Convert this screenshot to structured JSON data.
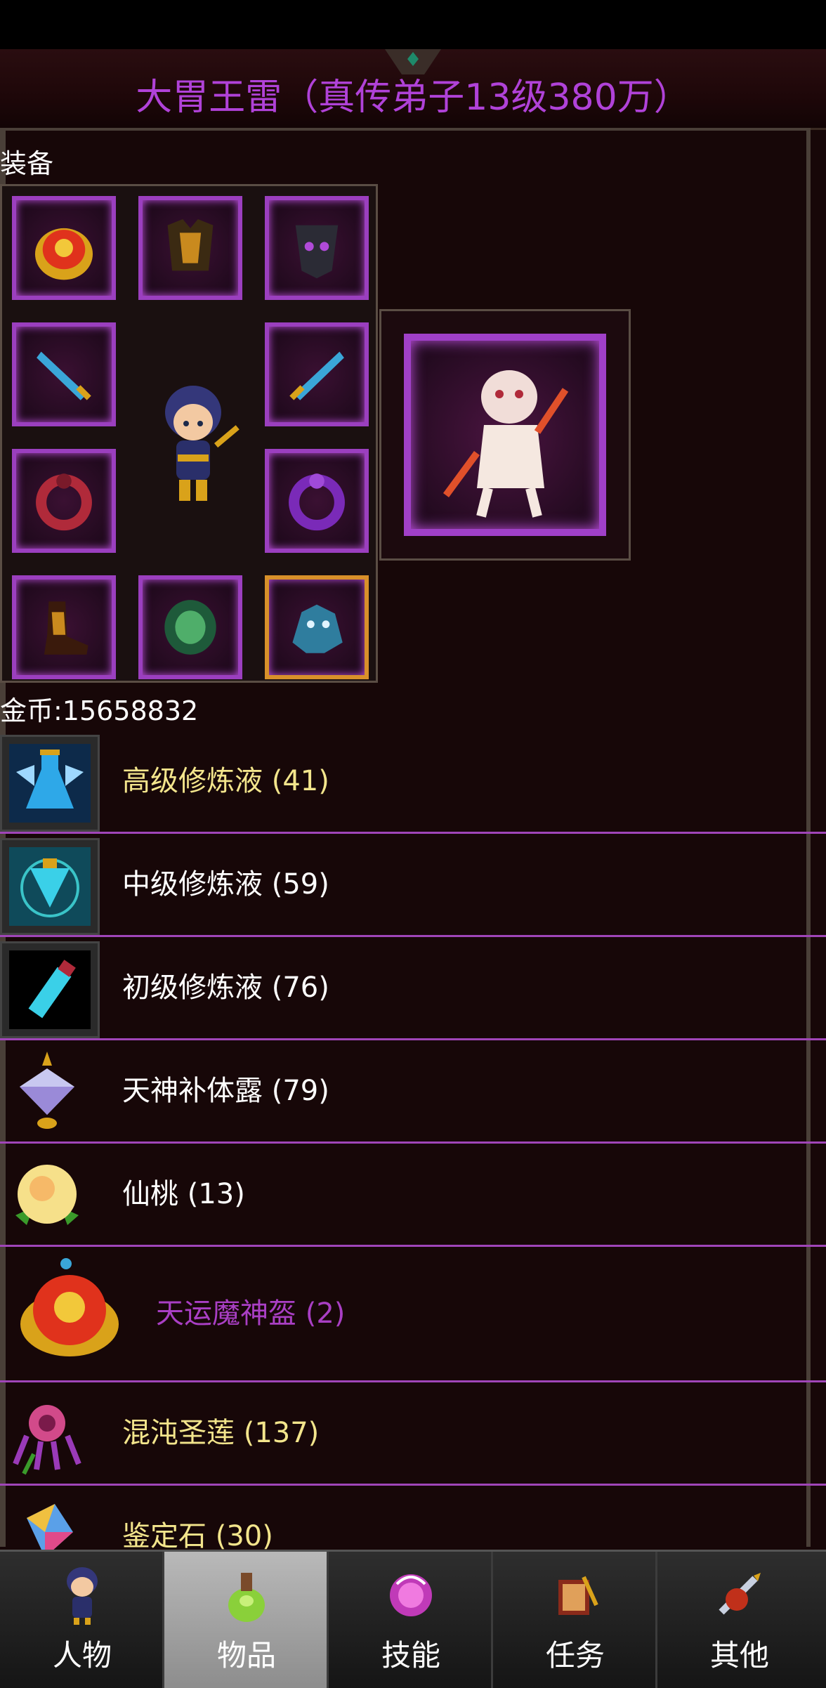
{
  "header": {
    "title": "大胃王雷（真传弟子13级380万）"
  },
  "equipment": {
    "label": "装备",
    "slots": [
      {
        "icon": "helmet-icon"
      },
      {
        "icon": "armor-icon"
      },
      {
        "icon": "mask-icon"
      },
      {
        "icon": "sword-icon"
      },
      {
        "icon": "sword-icon"
      },
      {
        "icon": "ring-icon"
      },
      {
        "icon": "ring-icon"
      },
      {
        "icon": "boots-icon"
      },
      {
        "icon": "belt-icon"
      },
      {
        "icon": "mount-icon"
      }
    ],
    "pet_icon": "monkey-pet-icon"
  },
  "gold": "金币:15658832",
  "items": [
    {
      "name": "高级修炼液 (41)",
      "color": "#f3e58c",
      "icon": "potion-flask-icon"
    },
    {
      "name": "中级修炼液 (59)",
      "color": "#ffffff",
      "icon": "potion-bottle-icon"
    },
    {
      "name": "初级修炼液 (76)",
      "color": "#ffffff",
      "icon": "vial-icon"
    },
    {
      "name": "天神补体露 (79)",
      "color": "#ffffff",
      "icon": "crystal-icon"
    },
    {
      "name": "仙桃 (13)",
      "color": "#ffffff",
      "icon": "peach-icon"
    },
    {
      "name": "天运魔神盔 (2)",
      "color": "#a93fc4",
      "icon": "helmet-icon"
    },
    {
      "name": "混沌圣莲 (137)",
      "color": "#f3e58c",
      "icon": "lotus-icon"
    },
    {
      "name": "鉴定石 (30)",
      "color": "#f3e58c",
      "icon": "gem-icon"
    }
  ],
  "nav": [
    {
      "label": "人物",
      "icon": "character-icon",
      "active": false
    },
    {
      "label": "物品",
      "icon": "bag-icon",
      "active": true
    },
    {
      "label": "技能",
      "icon": "skill-icon",
      "active": false
    },
    {
      "label": "任务",
      "icon": "quest-icon",
      "active": false
    },
    {
      "label": "其他",
      "icon": "other-icon",
      "active": false
    }
  ]
}
